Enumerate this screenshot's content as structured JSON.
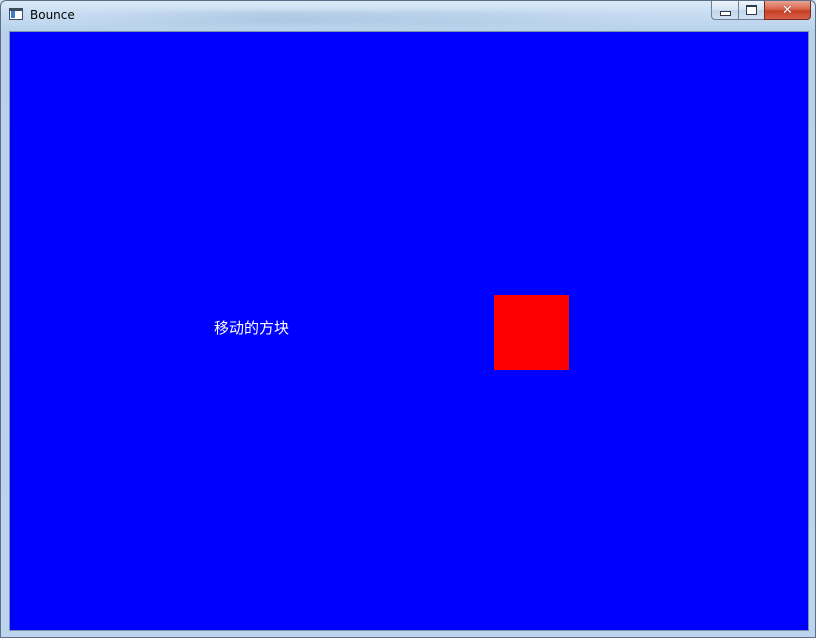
{
  "window": {
    "title": "Bounce",
    "caption": {
      "minimize_icon": "minimize-icon",
      "maximize_icon": "maximize-icon",
      "close_icon": "close-icon",
      "close_glyph": "✕"
    }
  },
  "scene": {
    "label": "移动的方块",
    "background_color": "#0000ff",
    "square_color": "#ff0000",
    "label_color": "#ffffff"
  }
}
